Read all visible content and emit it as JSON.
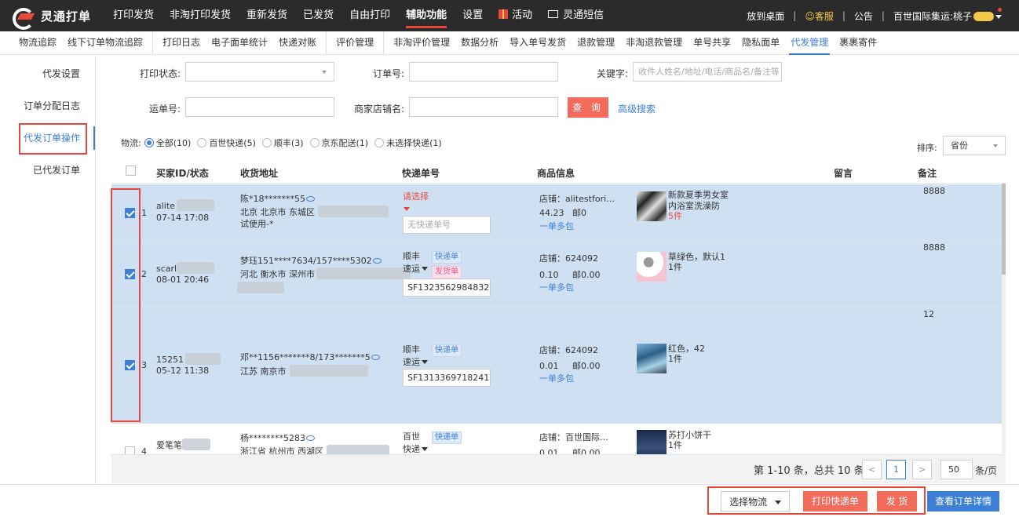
{
  "topbar": {
    "logo": "灵通打单",
    "nav": [
      "打印发货",
      "非淘打印发货",
      "重新发货",
      "已发货",
      "自由打印",
      "辅助功能",
      "设置",
      "活动",
      "灵通短信"
    ],
    "active_nav": "辅助功能",
    "right": {
      "desktop": "放到桌面",
      "service": "客服",
      "notice": "公告",
      "user": "百世国际集运:桃子"
    }
  },
  "subnav": {
    "group1": [
      "物流追踪",
      "线下订单物流追踪"
    ],
    "group2": [
      "打印日志",
      "电子面单统计",
      "快递对账"
    ],
    "group3": [
      "评价管理"
    ],
    "group4": [
      "非淘评价管理",
      "数据分析",
      "导入单号发货",
      "退款管理",
      "非淘退款管理",
      "单号共享",
      "隐私面单",
      "代发管理",
      "裹裹寄件"
    ],
    "active": "代发管理"
  },
  "sidebar": {
    "items": [
      "代发设置",
      "订单分配日志",
      "代发订单操作",
      "已代发订单"
    ],
    "active": "代发订单操作"
  },
  "filters": {
    "print_status_label": "打印状态:",
    "order_no_label": "订单号:",
    "keyword_label": "关键字:",
    "keyword_placeholder": "收件人姓名/地址/电话/商品名/备注等",
    "waybill_label": "运单号:",
    "shop_label": "商家店铺名:",
    "query": "查 询",
    "advanced": "高级搜索"
  },
  "logistics_filter": {
    "label": "物流:",
    "options": [
      "全部(10)",
      "百世快递(5)",
      "顺丰(3)",
      "京东配送(1)",
      "未选择快递(1)"
    ],
    "selected": "全部(10)"
  },
  "sort": {
    "label": "排序:",
    "value": "省份"
  },
  "table": {
    "headers": [
      "买家ID/状态",
      "收货地址",
      "快递单号",
      "商品信息",
      "留言",
      "备注"
    ],
    "rows": [
      {
        "idx": "1",
        "buyer": "alite",
        "time": "07-14 17:08",
        "name_phone": "陈*18*******55",
        "addr": "北京 北京市 东城区 ",
        "addr2": "试使用-*",
        "courier": "请选择",
        "track": "无快递单号",
        "shop": "店铺：alitestfori…",
        "amount": "44.23",
        "post": "邮0",
        "multi": "一单多包",
        "product": "新款夏季男女室",
        "product2": "内浴室洗澡防",
        "qty": "5件",
        "remark": "8888"
      },
      {
        "idx": "2",
        "buyer": "scarl",
        "time": "08-01 20:46",
        "name_phone": "梦珏151****7634/157****5302",
        "addr": "河北 衡水市 深州市",
        "courier": "顺丰",
        "service": "速运",
        "tag1": "快递单",
        "tag2": "发货单",
        "track": "SF1323562984832",
        "shop": "店铺：624092",
        "amount": "0.10",
        "post": "邮0.00",
        "multi": "一单多包",
        "product": "草绿色，默认1",
        "qty": "1件",
        "remark": "8888"
      },
      {
        "idx": "3",
        "buyer": "15251",
        "time": "05-12 11:38",
        "name_phone": "邓**1156*******8/173*******5",
        "addr": "江苏 南京市",
        "courier": "顺丰",
        "service": "速运",
        "tag1": "快递单",
        "track": "SF1313369718241",
        "shop": "店铺：624092",
        "amount": "0.01",
        "post": "邮0.00",
        "multi": "一单多包",
        "product": "红色，42",
        "qty": "1件",
        "remark": "12"
      },
      {
        "idx": "4",
        "buyer": "爱笔笔",
        "name_phone": "杨********5283",
        "addr": "浙江省 杭州市 西湖区",
        "courier": "百世",
        "service": "快递",
        "tag1": "快递单",
        "shop": "店铺：百世国际…",
        "amount": "0.01",
        "post": "邮0.00",
        "product": "苏打小饼干",
        "qty": "1件"
      }
    ]
  },
  "pagination": {
    "info": "第 1-10 条，总共 10 条",
    "current": "1",
    "page_size": "50",
    "unit": "条/页",
    "prev": "<",
    "next": ">"
  },
  "bottom": {
    "select_logistics": "选择物流",
    "print_waybill": "打印快递单",
    "ship": "发 货",
    "view_detail": "查看订单详情"
  },
  "colors": {
    "accent": "#3d7fd6",
    "red": "#f26b5b",
    "highlight": "#e8483c",
    "row_selected": "#cfe0f3"
  }
}
